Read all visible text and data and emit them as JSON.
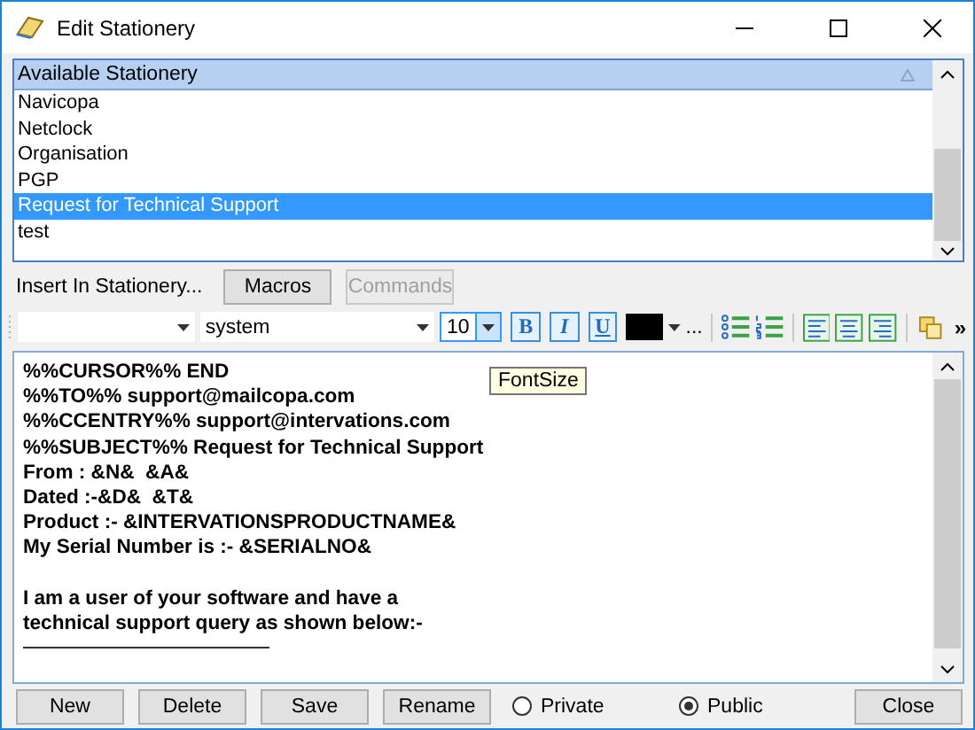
{
  "window": {
    "title": "Edit Stationery"
  },
  "stationery_list": {
    "header": "Available Stationery",
    "items": [
      {
        "label": "Navicopa",
        "selected": false
      },
      {
        "label": "Netclock",
        "selected": false
      },
      {
        "label": "Organisation",
        "selected": false
      },
      {
        "label": "PGP",
        "selected": false
      },
      {
        "label": "Request for Technical Support",
        "selected": true
      },
      {
        "label": "test",
        "selected": false
      }
    ]
  },
  "insert": {
    "label": "Insert In Stationery...",
    "buttons": [
      {
        "label": "Macros",
        "disabled": false
      },
      {
        "label": "Commands",
        "disabled": true
      }
    ]
  },
  "toolbar": {
    "font_family": "system",
    "font_size": "10",
    "format_buttons": [
      {
        "kind": "bold",
        "glyph": "B"
      },
      {
        "kind": "italic",
        "glyph": "I"
      },
      {
        "kind": "underline",
        "glyph": "U"
      }
    ],
    "more": "...",
    "overflow": "»"
  },
  "tooltip": "FontSize",
  "editor": {
    "paragraphs": [
      {
        "lines": [
          "%%CURSOR%% END",
          "%%TO%% support@mailcopa.com",
          "%%CCENTRY%% support@intervations.com",
          "%%SUBJECT%% Request for Technical Support",
          "From : &N&  &A&",
          "Dated :-&D&  &T&",
          "Product :- &INTERVATIONSPRODUCTNAME&",
          "My Serial Number is :- &SERIALNO&"
        ]
      },
      {
        "lines": [
          "I am a user of your software and have a",
          "technical support query as shown below:-"
        ]
      }
    ]
  },
  "bottom_buttons": [
    "New",
    "Delete",
    "Save",
    "Rename"
  ],
  "visibility": [
    {
      "label": "Private",
      "selected": false
    },
    {
      "label": "Public",
      "selected": true
    }
  ],
  "close_button": "Close"
}
